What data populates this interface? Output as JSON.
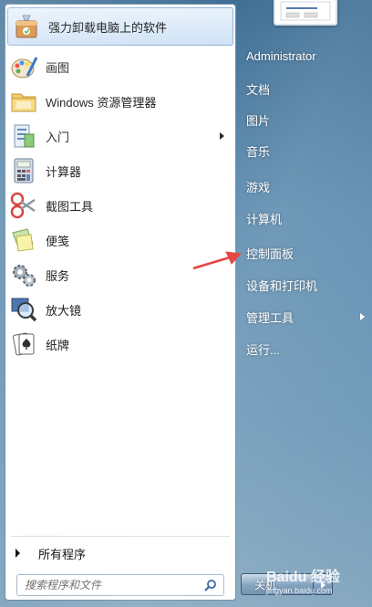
{
  "left_pane": {
    "items": [
      {
        "label": "强力卸载电脑上的软件",
        "icon": "uninstall-box-icon",
        "submenu": false
      },
      {
        "label": "画图",
        "icon": "paint-palette-icon",
        "submenu": false
      },
      {
        "label": "Windows 资源管理器",
        "icon": "folder-explorer-icon",
        "submenu": false
      },
      {
        "label": "入门",
        "icon": "getting-started-icon",
        "submenu": true
      },
      {
        "label": "计算器",
        "icon": "calculator-icon",
        "submenu": false
      },
      {
        "label": "截图工具",
        "icon": "scissors-icon",
        "submenu": false
      },
      {
        "label": "便笺",
        "icon": "sticky-notes-icon",
        "submenu": false
      },
      {
        "label": "服务",
        "icon": "gears-icon",
        "submenu": false
      },
      {
        "label": "放大镜",
        "icon": "magnifier-icon",
        "submenu": false
      },
      {
        "label": "纸牌",
        "icon": "cards-icon",
        "submenu": false
      }
    ],
    "all_programs": "所有程序",
    "search_placeholder": "搜索程序和文件"
  },
  "right_pane": {
    "items": [
      {
        "label": "Administrator",
        "submenu": false
      },
      {
        "label": "文档",
        "submenu": false
      },
      {
        "label": "图片",
        "submenu": false
      },
      {
        "label": "音乐",
        "submenu": false
      },
      {
        "label": "游戏",
        "submenu": false
      },
      {
        "label": "计算机",
        "submenu": false
      },
      {
        "label": "控制面板",
        "submenu": false
      },
      {
        "label": "设备和打印机",
        "submenu": false
      },
      {
        "label": "管理工具",
        "submenu": true
      },
      {
        "label": "运行...",
        "submenu": false
      }
    ],
    "shutdown_label": "关机"
  },
  "annotation": {
    "color": "#e53935"
  },
  "watermark": {
    "main": "Baidu 经验",
    "sub": "jingyan.baidu.com"
  }
}
